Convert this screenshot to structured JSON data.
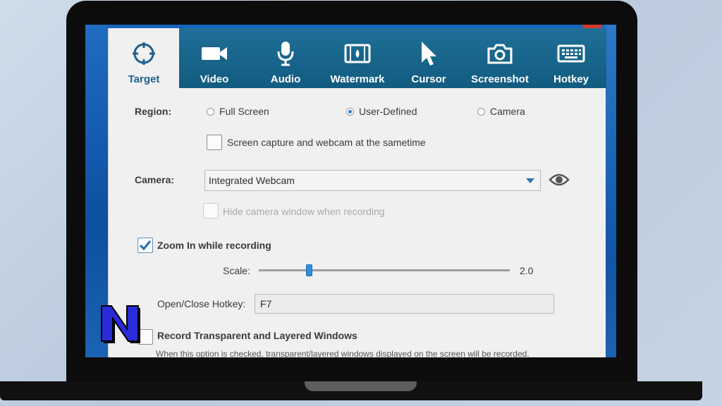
{
  "tabs": [
    {
      "label": "Target",
      "icon": "target-icon",
      "active": true
    },
    {
      "label": "Video",
      "icon": "video-camera-icon",
      "active": false
    },
    {
      "label": "Audio",
      "icon": "microphone-icon",
      "active": false
    },
    {
      "label": "Watermark",
      "icon": "watermark-icon",
      "active": false
    },
    {
      "label": "Cursor",
      "icon": "cursor-icon",
      "active": false
    },
    {
      "label": "Screenshot",
      "icon": "camera-icon",
      "active": false
    },
    {
      "label": "Hotkey",
      "icon": "keyboard-icon",
      "active": false
    }
  ],
  "region": {
    "label": "Region:",
    "options": [
      {
        "label": "Full Screen",
        "selected": false
      },
      {
        "label": "User-Defined",
        "selected": true
      },
      {
        "label": "Camera",
        "selected": false
      }
    ],
    "sametime_label": "Screen capture and webcam at the sametime",
    "sametime_checked": false
  },
  "camera": {
    "label": "Camera:",
    "value": "Integrated Webcam",
    "hide_label": "Hide camera window when recording",
    "hide_enabled": false
  },
  "zoom": {
    "label": "Zoom In while recording",
    "checked": true,
    "scale_label": "Scale:",
    "scale_value": "2.0",
    "scale_fraction": 0.2,
    "hotkey_label": "Open/Close Hotkey:",
    "hotkey_value": "F7"
  },
  "transparent": {
    "label": "Record Transparent and Layered Windows",
    "checked": false,
    "description": "When this option is checked, transparent/layered windows displayed on the screen will be recorded."
  },
  "colors": {
    "tab_bar": "#1a6690",
    "accent": "#2a79d0",
    "active_tab_text": "#1e5f8e",
    "logo_fill": "#2a2cd9"
  }
}
